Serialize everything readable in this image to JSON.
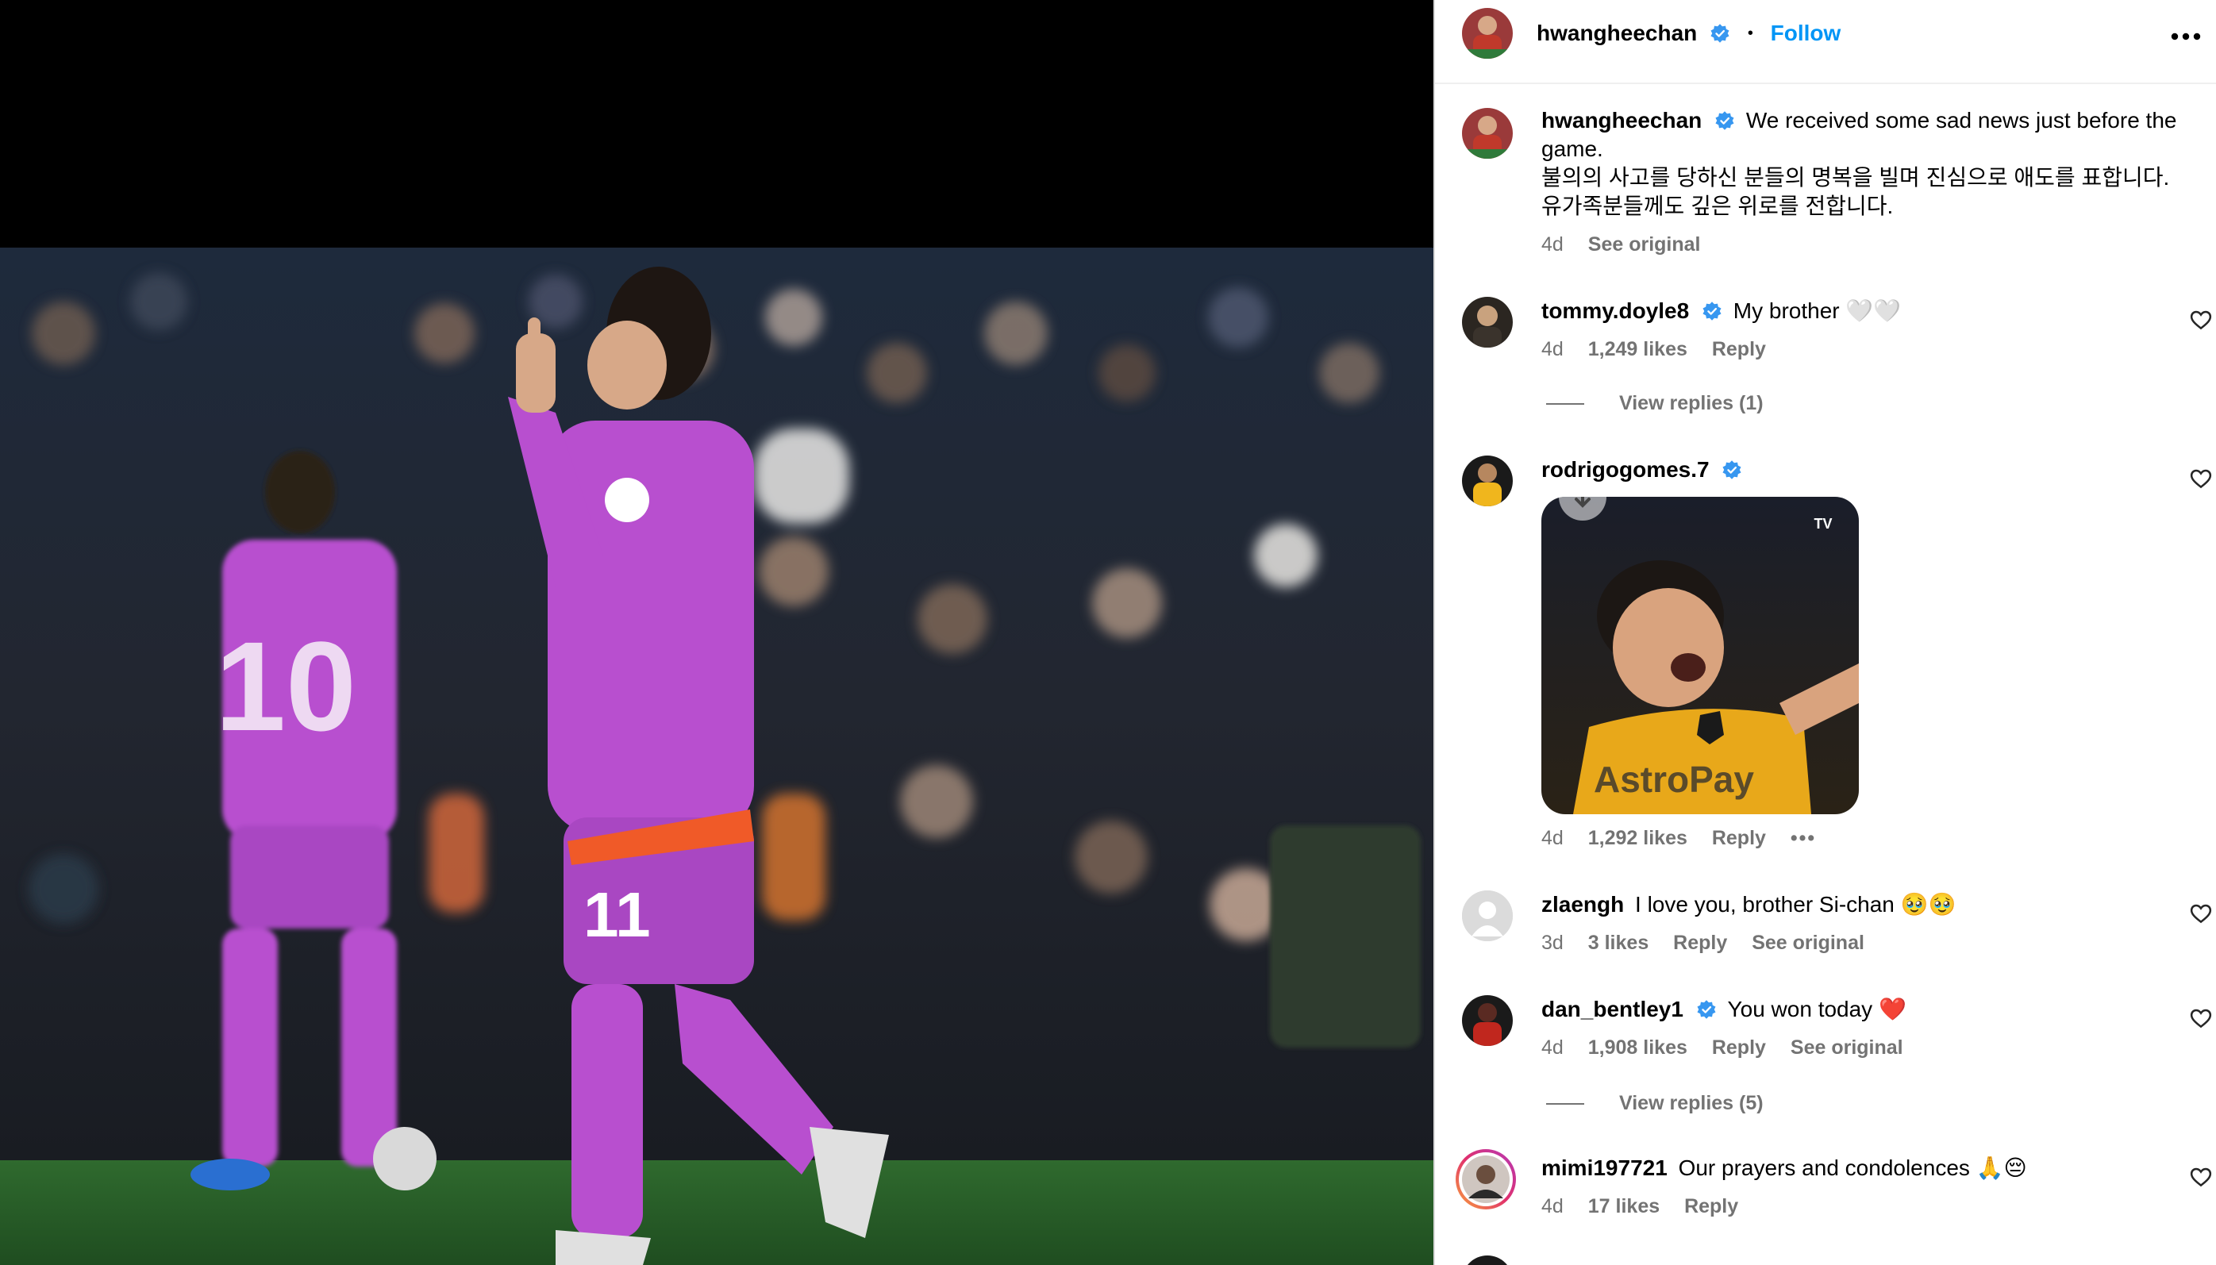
{
  "post": {
    "author": "hwangheechan",
    "follow_label": "Follow",
    "separator": "•",
    "caption_lines": [
      "We received some sad news just before the",
      "game.",
      "불의의 사고를 당하신 분들의 명복을 빌며 진심으로 애도를 표합니다.",
      "유가족분들께도 깊은 위로를 전합니다."
    ],
    "caption_time": "4d",
    "caption_see_original": "See original",
    "photo_jersey_numbers": [
      "10",
      "11"
    ]
  },
  "comments": [
    {
      "username": "tommy.doyle8",
      "verified": true,
      "text": "My brother 🤍🤍",
      "time": "4d",
      "likes": "1,249 likes",
      "reply": "Reply",
      "view_replies": "View replies (1)"
    },
    {
      "username": "rodrigogomes.7",
      "verified": true,
      "text": "",
      "gif_text": "AstroPay",
      "gif_badge": "TV",
      "time": "4d",
      "likes": "1,292 likes",
      "reply": "Reply",
      "more": "•••"
    },
    {
      "username": "zlaengh",
      "verified": false,
      "text": "I love you, brother Si-chan 🥹🥹",
      "time": "3d",
      "likes": "3 likes",
      "reply": "Reply",
      "see_original": "See original"
    },
    {
      "username": "dan_bentley1",
      "verified": true,
      "text": "You won today ❤️",
      "time": "4d",
      "likes": "1,908 likes",
      "reply": "Reply",
      "see_original": "See original",
      "view_replies": "View replies (5)"
    },
    {
      "username": "mimi197721",
      "verified": false,
      "text": "Our prayers and condolences 🙏😔",
      "time": "4d",
      "likes": "17 likes",
      "reply": "Reply"
    }
  ],
  "colors": {
    "link_blue": "#0095f6",
    "verified_blue": "#3797f0",
    "secondary_text": "#737373",
    "kit_purple": "#b84fcf",
    "gif_yellow": "#e8a81a"
  }
}
